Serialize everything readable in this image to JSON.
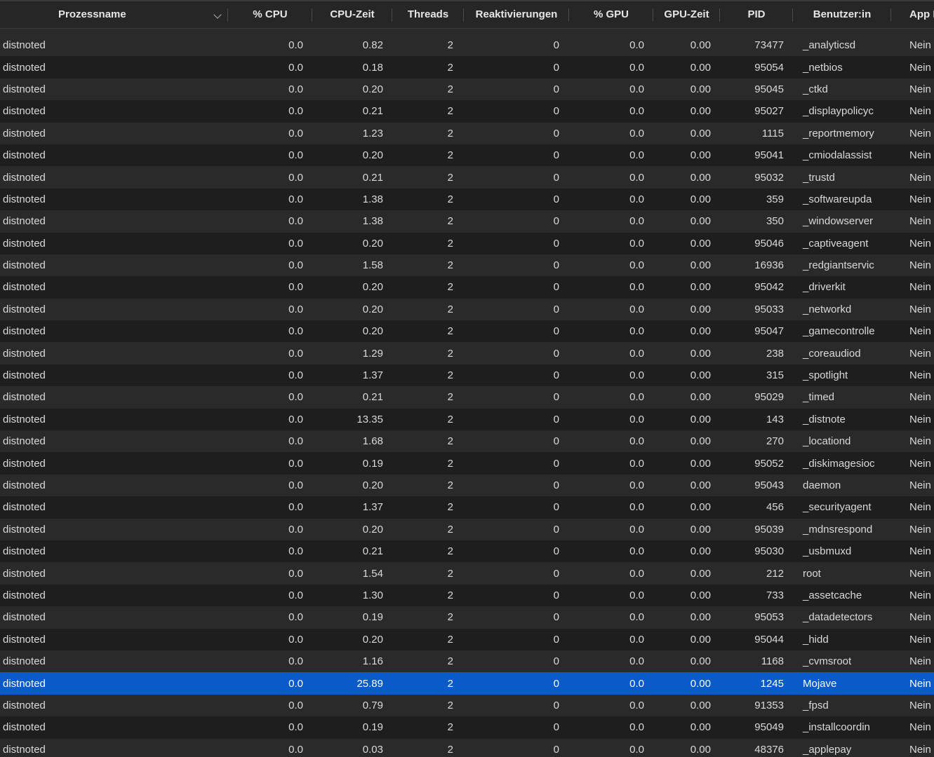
{
  "columns": {
    "name": "Prozessname",
    "cpu": "% CPU",
    "cpu_time": "CPU-Zeit",
    "threads": "Threads",
    "wakeups": "Reaktivierungen",
    "gpu": "% GPU",
    "gpu_time": "GPU-Zeit",
    "pid": "PID",
    "user": "Benutzer:in",
    "app_nap": "App Na"
  },
  "sort": {
    "column": "name",
    "direction": "descending",
    "icon": "chevron-down-icon"
  },
  "selected_row_index": 29,
  "colors": {
    "selection": "#0a5ac9",
    "row_alt": "#2a2a2b",
    "row_base": "#1e1e1f"
  },
  "rows": [
    {
      "name": "distnoted",
      "cpu": "0.0",
      "cpu_time": "0.82",
      "threads": "2",
      "wakeups": "0",
      "gpu": "0.0",
      "gpu_time": "0.00",
      "pid": "73477",
      "user": "_analyticsd",
      "app_nap": "Nein"
    },
    {
      "name": "distnoted",
      "cpu": "0.0",
      "cpu_time": "0.18",
      "threads": "2",
      "wakeups": "0",
      "gpu": "0.0",
      "gpu_time": "0.00",
      "pid": "95054",
      "user": "_netbios",
      "app_nap": "Nein"
    },
    {
      "name": "distnoted",
      "cpu": "0.0",
      "cpu_time": "0.20",
      "threads": "2",
      "wakeups": "0",
      "gpu": "0.0",
      "gpu_time": "0.00",
      "pid": "95045",
      "user": "_ctkd",
      "app_nap": "Nein"
    },
    {
      "name": "distnoted",
      "cpu": "0.0",
      "cpu_time": "0.21",
      "threads": "2",
      "wakeups": "0",
      "gpu": "0.0",
      "gpu_time": "0.00",
      "pid": "95027",
      "user": "_displaypolicyc",
      "app_nap": "Nein"
    },
    {
      "name": "distnoted",
      "cpu": "0.0",
      "cpu_time": "1.23",
      "threads": "2",
      "wakeups": "0",
      "gpu": "0.0",
      "gpu_time": "0.00",
      "pid": "1115",
      "user": "_reportmemory",
      "app_nap": "Nein"
    },
    {
      "name": "distnoted",
      "cpu": "0.0",
      "cpu_time": "0.20",
      "threads": "2",
      "wakeups": "0",
      "gpu": "0.0",
      "gpu_time": "0.00",
      "pid": "95041",
      "user": "_cmiodalassist",
      "app_nap": "Nein"
    },
    {
      "name": "distnoted",
      "cpu": "0.0",
      "cpu_time": "0.21",
      "threads": "2",
      "wakeups": "0",
      "gpu": "0.0",
      "gpu_time": "0.00",
      "pid": "95032",
      "user": "_trustd",
      "app_nap": "Nein"
    },
    {
      "name": "distnoted",
      "cpu": "0.0",
      "cpu_time": "1.38",
      "threads": "2",
      "wakeups": "0",
      "gpu": "0.0",
      "gpu_time": "0.00",
      "pid": "359",
      "user": "_softwareupda",
      "app_nap": "Nein"
    },
    {
      "name": "distnoted",
      "cpu": "0.0",
      "cpu_time": "1.38",
      "threads": "2",
      "wakeups": "0",
      "gpu": "0.0",
      "gpu_time": "0.00",
      "pid": "350",
      "user": "_windowserver",
      "app_nap": "Nein"
    },
    {
      "name": "distnoted",
      "cpu": "0.0",
      "cpu_time": "0.20",
      "threads": "2",
      "wakeups": "0",
      "gpu": "0.0",
      "gpu_time": "0.00",
      "pid": "95046",
      "user": "_captiveagent",
      "app_nap": "Nein"
    },
    {
      "name": "distnoted",
      "cpu": "0.0",
      "cpu_time": "1.58",
      "threads": "2",
      "wakeups": "0",
      "gpu": "0.0",
      "gpu_time": "0.00",
      "pid": "16936",
      "user": "_redgiantservic",
      "app_nap": "Nein"
    },
    {
      "name": "distnoted",
      "cpu": "0.0",
      "cpu_time": "0.20",
      "threads": "2",
      "wakeups": "0",
      "gpu": "0.0",
      "gpu_time": "0.00",
      "pid": "95042",
      "user": "_driverkit",
      "app_nap": "Nein"
    },
    {
      "name": "distnoted",
      "cpu": "0.0",
      "cpu_time": "0.20",
      "threads": "2",
      "wakeups": "0",
      "gpu": "0.0",
      "gpu_time": "0.00",
      "pid": "95033",
      "user": "_networkd",
      "app_nap": "Nein"
    },
    {
      "name": "distnoted",
      "cpu": "0.0",
      "cpu_time": "0.20",
      "threads": "2",
      "wakeups": "0",
      "gpu": "0.0",
      "gpu_time": "0.00",
      "pid": "95047",
      "user": "_gamecontrolle",
      "app_nap": "Nein"
    },
    {
      "name": "distnoted",
      "cpu": "0.0",
      "cpu_time": "1.29",
      "threads": "2",
      "wakeups": "0",
      "gpu": "0.0",
      "gpu_time": "0.00",
      "pid": "238",
      "user": "_coreaudiod",
      "app_nap": "Nein"
    },
    {
      "name": "distnoted",
      "cpu": "0.0",
      "cpu_time": "1.37",
      "threads": "2",
      "wakeups": "0",
      "gpu": "0.0",
      "gpu_time": "0.00",
      "pid": "315",
      "user": "_spotlight",
      "app_nap": "Nein"
    },
    {
      "name": "distnoted",
      "cpu": "0.0",
      "cpu_time": "0.21",
      "threads": "2",
      "wakeups": "0",
      "gpu": "0.0",
      "gpu_time": "0.00",
      "pid": "95029",
      "user": "_timed",
      "app_nap": "Nein"
    },
    {
      "name": "distnoted",
      "cpu": "0.0",
      "cpu_time": "13.35",
      "threads": "2",
      "wakeups": "0",
      "gpu": "0.0",
      "gpu_time": "0.00",
      "pid": "143",
      "user": "_distnote",
      "app_nap": "Nein"
    },
    {
      "name": "distnoted",
      "cpu": "0.0",
      "cpu_time": "1.68",
      "threads": "2",
      "wakeups": "0",
      "gpu": "0.0",
      "gpu_time": "0.00",
      "pid": "270",
      "user": "_locationd",
      "app_nap": "Nein"
    },
    {
      "name": "distnoted",
      "cpu": "0.0",
      "cpu_time": "0.19",
      "threads": "2",
      "wakeups": "0",
      "gpu": "0.0",
      "gpu_time": "0.00",
      "pid": "95052",
      "user": "_diskimagesioc",
      "app_nap": "Nein"
    },
    {
      "name": "distnoted",
      "cpu": "0.0",
      "cpu_time": "0.20",
      "threads": "2",
      "wakeups": "0",
      "gpu": "0.0",
      "gpu_time": "0.00",
      "pid": "95043",
      "user": "daemon",
      "app_nap": "Nein"
    },
    {
      "name": "distnoted",
      "cpu": "0.0",
      "cpu_time": "1.37",
      "threads": "2",
      "wakeups": "0",
      "gpu": "0.0",
      "gpu_time": "0.00",
      "pid": "456",
      "user": "_securityagent",
      "app_nap": "Nein"
    },
    {
      "name": "distnoted",
      "cpu": "0.0",
      "cpu_time": "0.20",
      "threads": "2",
      "wakeups": "0",
      "gpu": "0.0",
      "gpu_time": "0.00",
      "pid": "95039",
      "user": "_mdnsrespond",
      "app_nap": "Nein"
    },
    {
      "name": "distnoted",
      "cpu": "0.0",
      "cpu_time": "0.21",
      "threads": "2",
      "wakeups": "0",
      "gpu": "0.0",
      "gpu_time": "0.00",
      "pid": "95030",
      "user": "_usbmuxd",
      "app_nap": "Nein"
    },
    {
      "name": "distnoted",
      "cpu": "0.0",
      "cpu_time": "1.54",
      "threads": "2",
      "wakeups": "0",
      "gpu": "0.0",
      "gpu_time": "0.00",
      "pid": "212",
      "user": "root",
      "app_nap": "Nein"
    },
    {
      "name": "distnoted",
      "cpu": "0.0",
      "cpu_time": "1.30",
      "threads": "2",
      "wakeups": "0",
      "gpu": "0.0",
      "gpu_time": "0.00",
      "pid": "733",
      "user": "_assetcache",
      "app_nap": "Nein"
    },
    {
      "name": "distnoted",
      "cpu": "0.0",
      "cpu_time": "0.19",
      "threads": "2",
      "wakeups": "0",
      "gpu": "0.0",
      "gpu_time": "0.00",
      "pid": "95053",
      "user": "_datadetectors",
      "app_nap": "Nein"
    },
    {
      "name": "distnoted",
      "cpu": "0.0",
      "cpu_time": "0.20",
      "threads": "2",
      "wakeups": "0",
      "gpu": "0.0",
      "gpu_time": "0.00",
      "pid": "95044",
      "user": "_hidd",
      "app_nap": "Nein"
    },
    {
      "name": "distnoted",
      "cpu": "0.0",
      "cpu_time": "1.16",
      "threads": "2",
      "wakeups": "0",
      "gpu": "0.0",
      "gpu_time": "0.00",
      "pid": "1168",
      "user": "_cvmsroot",
      "app_nap": "Nein"
    },
    {
      "name": "distnoted",
      "cpu": "0.0",
      "cpu_time": "25.89",
      "threads": "2",
      "wakeups": "0",
      "gpu": "0.0",
      "gpu_time": "0.00",
      "pid": "1245",
      "user": "Mojave",
      "app_nap": "Nein"
    },
    {
      "name": "distnoted",
      "cpu": "0.0",
      "cpu_time": "0.79",
      "threads": "2",
      "wakeups": "0",
      "gpu": "0.0",
      "gpu_time": "0.00",
      "pid": "91353",
      "user": "_fpsd",
      "app_nap": "Nein"
    },
    {
      "name": "distnoted",
      "cpu": "0.0",
      "cpu_time": "0.19",
      "threads": "2",
      "wakeups": "0",
      "gpu": "0.0",
      "gpu_time": "0.00",
      "pid": "95049",
      "user": "_installcoordin",
      "app_nap": "Nein"
    },
    {
      "name": "distnoted",
      "cpu": "0.0",
      "cpu_time": "0.03",
      "threads": "2",
      "wakeups": "0",
      "gpu": "0.0",
      "gpu_time": "0.00",
      "pid": "48376",
      "user": "_applepay",
      "app_nap": "Nein"
    }
  ]
}
